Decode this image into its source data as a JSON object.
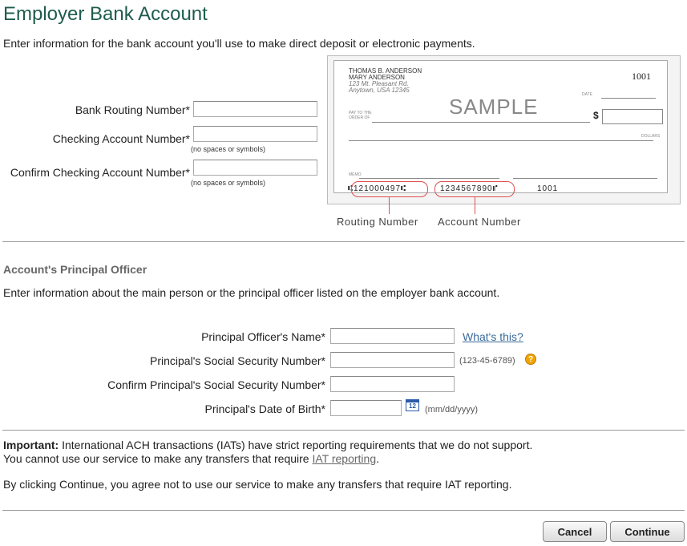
{
  "page": {
    "title": "Employer Bank Account",
    "intro": "Enter information for the bank account you'll use to make direct deposit or electronic payments."
  },
  "bank": {
    "routing_label": "Bank Routing Number*",
    "routing_value": "",
    "checking_label": "Checking Account Number*",
    "checking_value": "",
    "checking_hint": "(no spaces or symbols)",
    "confirm_label": "Confirm Checking Account Number*",
    "confirm_value": "",
    "confirm_hint": "(no spaces or symbols)"
  },
  "check_image": {
    "owner_line1": "THOMAS B. ANDERSON",
    "owner_line2": "MARY ANDERSON",
    "address1": "123 Mt. Pleasant Rd.",
    "address2": "Anytown, USA 12345",
    "check_number": "1001",
    "date_label": "DATE",
    "pay_to_label1": "PAY TO THE",
    "pay_to_label2": "ORDER OF",
    "sample_text": "SAMPLE",
    "dollar_sign": "$",
    "dollars_label": "DOLLARS",
    "memo_label": "MEMO",
    "micr_routing": "⑆121000497⑆",
    "micr_account": "1234567890⑈",
    "micr_check": "1001",
    "routing_caption": "Routing Number",
    "account_caption": "Account Number"
  },
  "principal": {
    "heading": "Account's Principal Officer",
    "intro": "Enter information about the main person or the principal officer listed on the employer bank account.",
    "name_label": "Principal Officer's Name*",
    "name_value": "",
    "whats_this": "What's this?",
    "ssn_label": "Principal's Social Security Number*",
    "ssn_value": "",
    "ssn_hint": "(123-45-6789)",
    "confirm_ssn_label": "Confirm Principal's Social Security Number*",
    "confirm_ssn_value": "",
    "dob_label": "Principal's Date of Birth*",
    "dob_value": "",
    "dob_hint": "(mm/dd/yyyy)",
    "calendar_day": "12"
  },
  "notice": {
    "important_label": "Important:",
    "line1": "International ACH transactions (IATs) have strict reporting requirements that we do not support.",
    "line2_prefix": "You cannot use our service to make any transfers that require ",
    "line2_link": "IAT reporting",
    "line2_suffix": ".",
    "agreement": "By clicking Continue, you agree not to use our service to make any transfers that require IAT reporting."
  },
  "buttons": {
    "cancel": "Cancel",
    "continue": "Continue"
  },
  "colors": {
    "title": "#1f5c4e",
    "link": "#3a6a9a",
    "help_icon": "#f0a500",
    "calendar_icon": "#2a5aa8",
    "micr_circle": "#e05050"
  }
}
